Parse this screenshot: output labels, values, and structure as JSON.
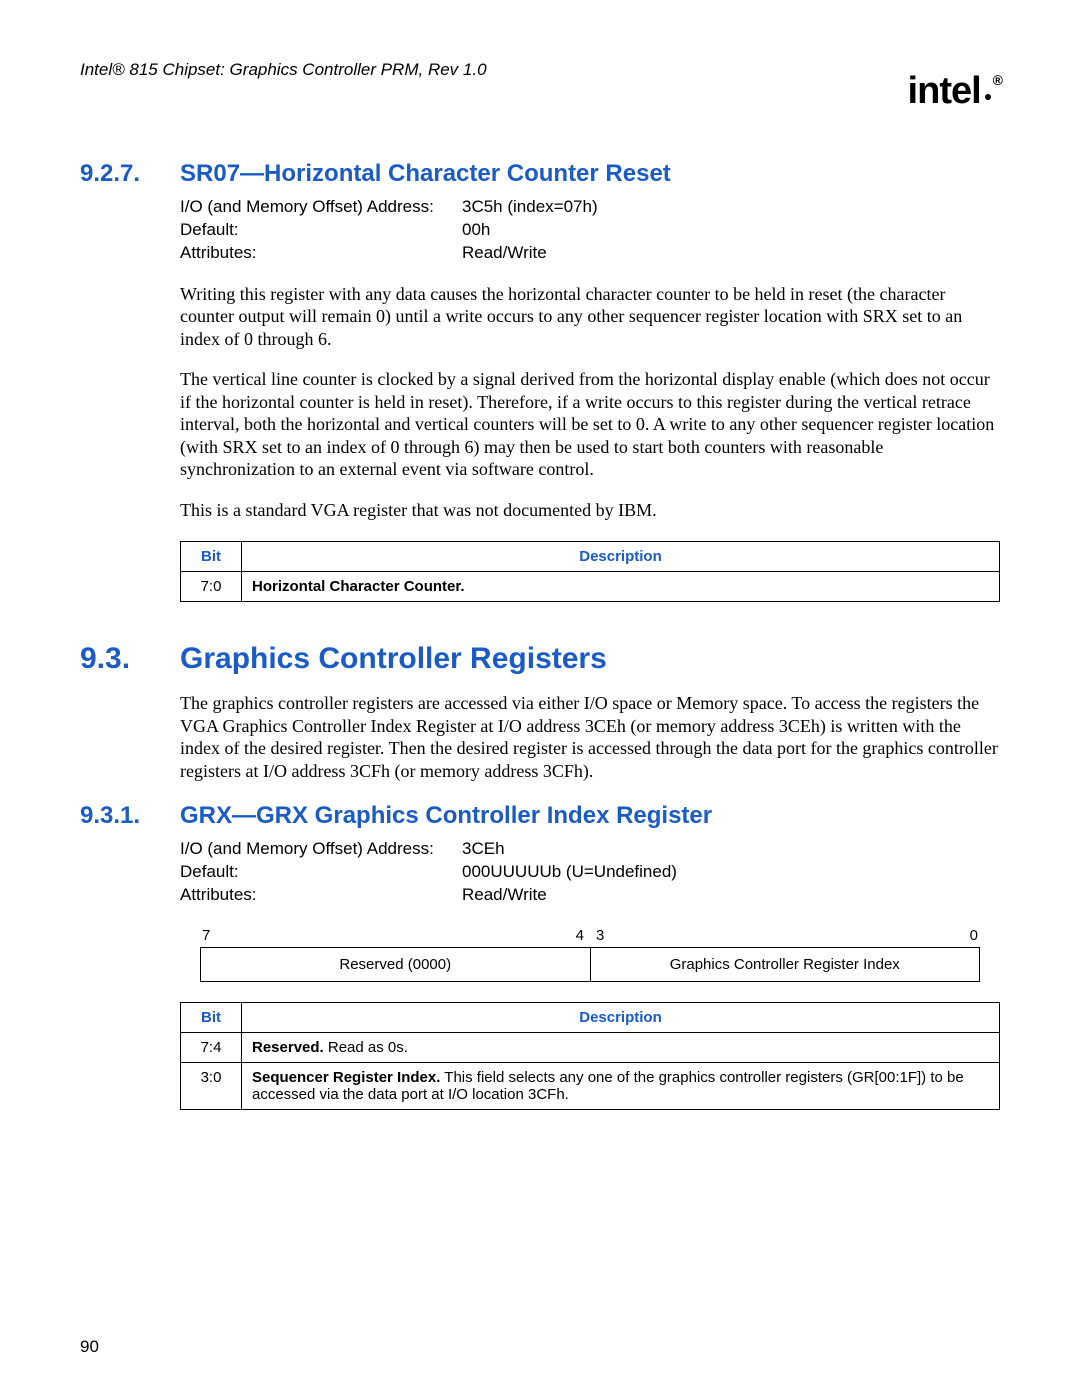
{
  "header": {
    "running": "Intel® 815 Chipset: Graphics Controller PRM, Rev 1.0",
    "logo": "intel"
  },
  "s927": {
    "num": "9.2.7.",
    "title": "SR07—Horizontal Character Counter Reset",
    "info": {
      "addr_label": "I/O (and Memory Offset) Address:",
      "addr_value": "3C5h (index=07h)",
      "default_label": "Default:",
      "default_value": "00h",
      "attr_label": "Attributes:",
      "attr_value": "Read/Write"
    },
    "p1": "Writing this register with any data causes the horizontal character counter to be held in reset (the character counter output will remain 0) until a write occurs to any other sequencer register location with SRX set to an index of 0 through 6.",
    "p2": "The vertical line counter is clocked by a signal derived from the horizontal display enable (which does not occur if the horizontal counter is held in reset). Therefore, if a write occurs to this register during the vertical retrace interval, both the horizontal and vertical counters will be set to 0. A write to any other sequencer register location (with SRX set to an index of 0 through 6) may then be used to start both counters with reasonable synchronization to an external event via software control.",
    "p3": "This is a standard VGA register that was not documented by IBM.",
    "table": {
      "h_bit": "Bit",
      "h_desc": "Description",
      "row0_bit": "7:0",
      "row0_desc": "Horizontal Character Counter."
    }
  },
  "s93": {
    "num": "9.3.",
    "title": "Graphics Controller Registers",
    "p1": "The graphics controller registers are accessed via either I/O space or Memory space. To access the registers the VGA Graphics Controller Index Register at I/O address 3CEh (or memory address 3CEh) is written with the index of the desired register. Then the desired register is accessed through the data port for the graphics controller registers at I/O address 3CFh (or memory address 3CFh)."
  },
  "s931": {
    "num": "9.3.1.",
    "title": "GRX—GRX Graphics Controller Index Register",
    "info": {
      "addr_label": "I/O (and Memory Offset) Address:",
      "addr_value": "3CEh",
      "default_label": "Default:",
      "default_value": "000UUUUUb (U=Undefined)",
      "attr_label": "Attributes:",
      "attr_value": "Read/Write"
    },
    "diagram": {
      "b7": "7",
      "b4": "4",
      "b3": "3",
      "b0": "0",
      "left": "Reserved (0000)",
      "right": "Graphics Controller Register Index"
    },
    "table": {
      "h_bit": "Bit",
      "h_desc": "Description",
      "row0_bit": "7:4",
      "row0_bold": "Reserved.",
      "row0_rest": " Read as 0s.",
      "row1_bit": "3:0",
      "row1_bold": "Sequencer Register Index.",
      "row1_rest": " This field selects any one of the graphics controller registers (GR[00:1F]) to be accessed via the data port at I/O location 3CFh."
    }
  },
  "page_number": "90"
}
